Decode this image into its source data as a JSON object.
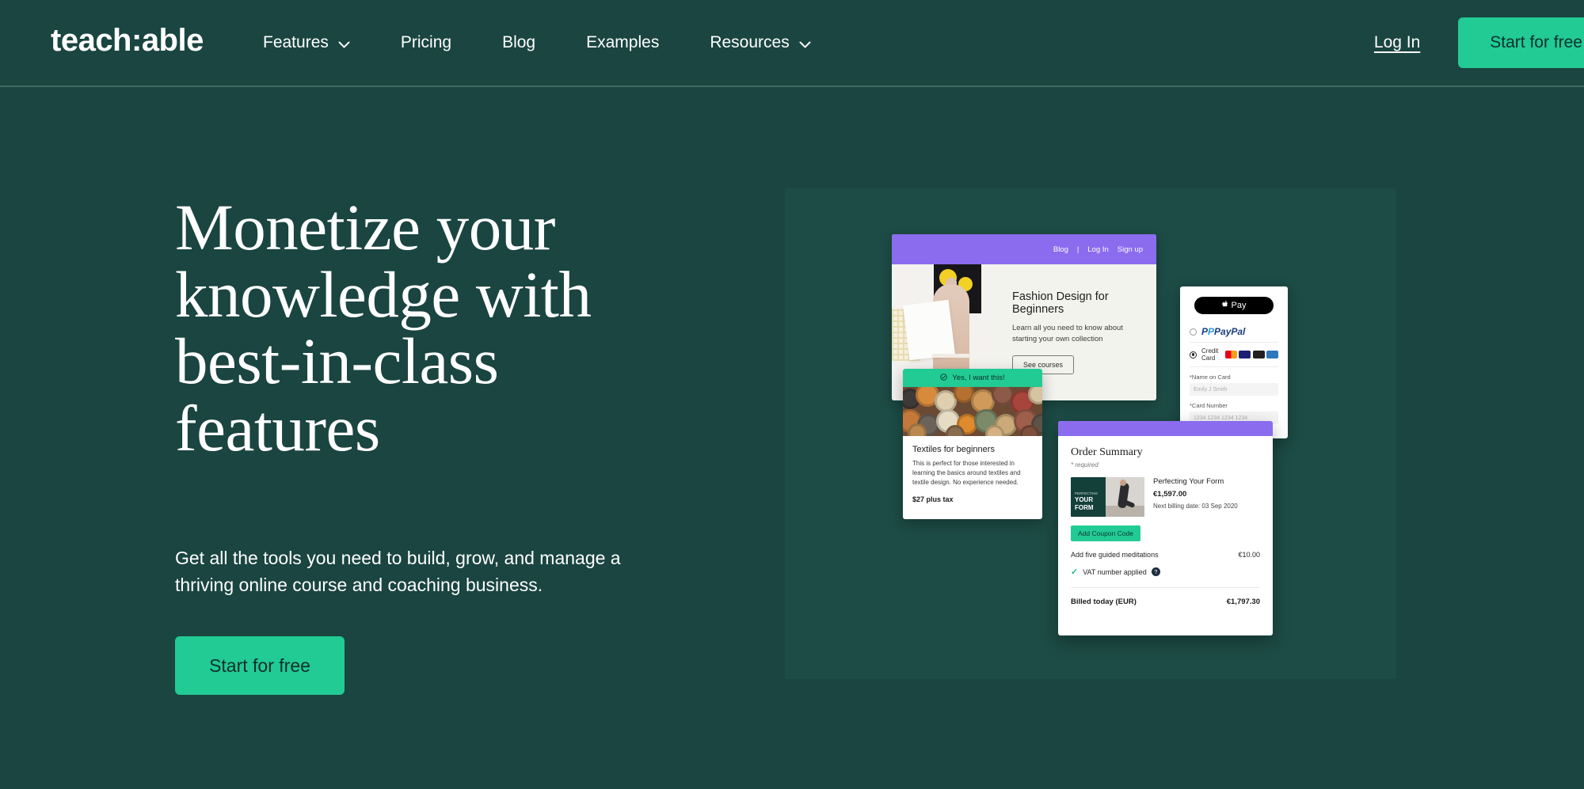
{
  "header": {
    "logo": "teach:able",
    "nav": [
      {
        "label": "Features",
        "has_chevron": true,
        "icon": "chevron-down-icon"
      },
      {
        "label": "Pricing",
        "has_chevron": false
      },
      {
        "label": "Blog",
        "has_chevron": false
      },
      {
        "label": "Examples",
        "has_chevron": false
      },
      {
        "label": "Resources",
        "has_chevron": true,
        "icon": "chevron-down-icon"
      }
    ],
    "login_label": "Log In",
    "cta_label": "Start for free"
  },
  "hero": {
    "heading": "Monetize your knowledge with best-in-class features",
    "subheading": "Get all the tools you need to build, grow, and manage a thriving online course and coaching business.",
    "cta_label": "Start for free"
  },
  "mockups": {
    "course_card": {
      "nav": [
        "Blog",
        "|",
        "Log In",
        "Sign up"
      ],
      "title": "Fashion Design for Beginners",
      "description": "Learn all you need to know about starting your own collection",
      "button_label": "See courses"
    },
    "textiles_card": {
      "banner_label": "Yes, I want this!",
      "banner_icon": "check-circle-icon",
      "title": "Textiles for beginners",
      "description": "This is perfect for those interested in learning the basics around textiles and textile design. No experience needed.",
      "price": "$27 plus tax"
    },
    "payment_card": {
      "apple_pay_label": "Pay",
      "apple_icon": "apple-logo-icon",
      "paypal_label": "PayPal",
      "credit_card_label": "Credit Card",
      "card_brands": [
        "mastercard-icon",
        "visa-icon",
        "discover-icon",
        "amex-icon"
      ],
      "name_label": "*Name on Card",
      "name_placeholder": "Emily J Smith",
      "number_label": "*Card Number",
      "number_placeholder": "1234 1234 1234 1234"
    },
    "order_card": {
      "title": "Order Summary",
      "required_note": "* required",
      "thumb_sub": "PERFECTING",
      "thumb_line1": "YOUR",
      "thumb_line2": "FORM",
      "item_name": "Perfecting Your Form",
      "item_price": "€1,597.00",
      "next_billing": "Next billing date: 03 Sep 2020",
      "coupon_label": "Add Coupon Code",
      "addon_label": "Add five guided meditations",
      "addon_price": "€10.00",
      "vat_label": "VAT number applied",
      "vat_icon": "question-mark-icon",
      "total_label": "Billed today (EUR)",
      "total_price": "€1,797.30"
    }
  },
  "colors": {
    "background": "#1a4540",
    "panel": "#1d4b45",
    "accent_green": "#21cb93",
    "purple": "#8b6cee",
    "text_light": "#ffffff"
  }
}
